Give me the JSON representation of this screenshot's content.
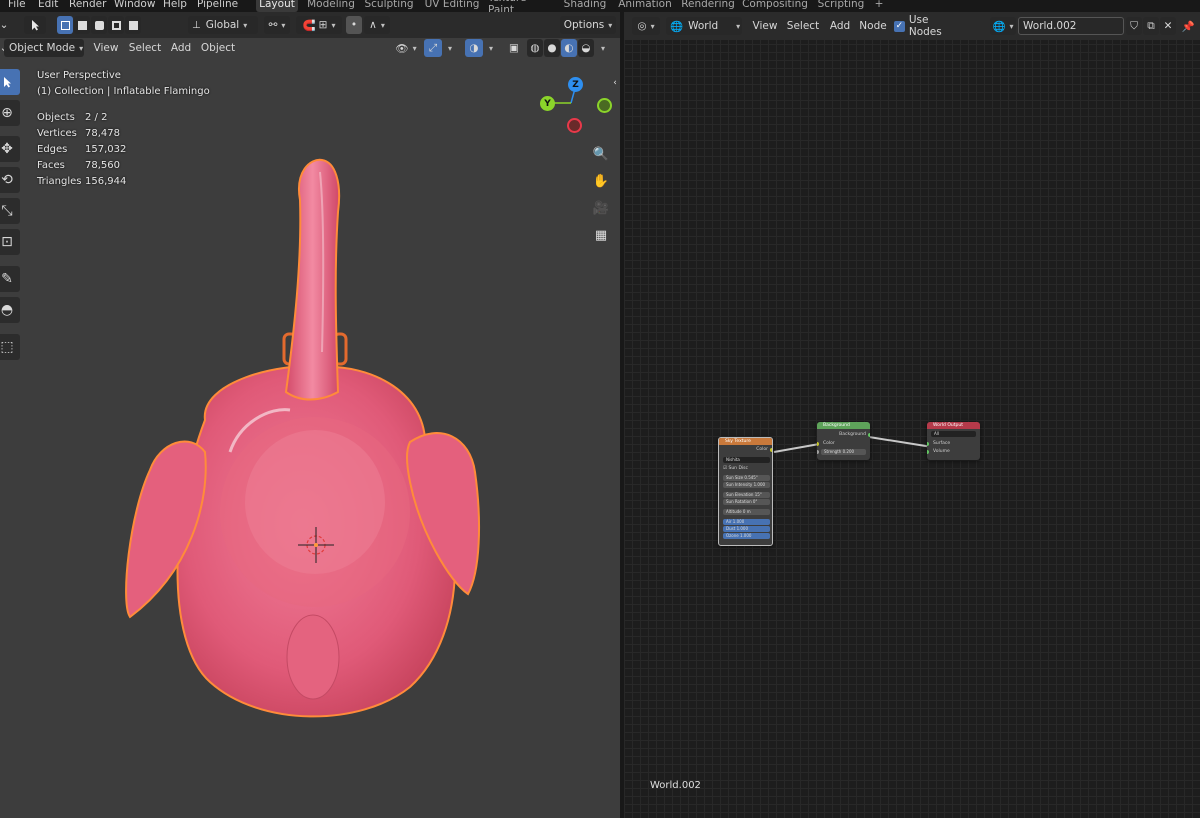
{
  "menu": {
    "items": [
      "File",
      "Edit",
      "Render",
      "Window",
      "Help",
      "Pipeline"
    ]
  },
  "workspaces": {
    "tabs": [
      "Layout",
      "Modeling",
      "Sculpting",
      "UV Editing",
      "Texture Paint",
      "Shading",
      "Animation",
      "Rendering",
      "Compositing",
      "Scripting"
    ],
    "active": "Layout",
    "add_symbol": "+"
  },
  "viewport": {
    "header": {
      "transform_orientation": "Global",
      "options_label": "Options",
      "mode": "Object Mode",
      "menus": [
        "View",
        "Select",
        "Add",
        "Object"
      ]
    },
    "info": {
      "view_name": "User Perspective",
      "collection": "(1) Collection | Inflatable Flamingo"
    },
    "stats": [
      {
        "key": "Objects",
        "value": "2 / 2"
      },
      {
        "key": "Vertices",
        "value": "78,478"
      },
      {
        "key": "Edges",
        "value": "157,032"
      },
      {
        "key": "Faces",
        "value": "78,560"
      },
      {
        "key": "Triangles",
        "value": "156,944"
      }
    ],
    "gizmo": {
      "z_label": "Z",
      "y_label": "Y",
      "z_color": "#2e8ff0",
      "y_color": "#8bd42a",
      "x_color": "#e8394a"
    },
    "object_color": "#e7607f",
    "outline_color": "#ff8b3a"
  },
  "node_editor": {
    "header": {
      "shader_type": "World",
      "menus": [
        "View",
        "Select",
        "Add",
        "Node"
      ],
      "use_nodes_label": "Use Nodes",
      "world_name": "World.002"
    },
    "footer_label": "World.002",
    "nodes": {
      "sky": {
        "title": "Sky Texture",
        "header_color": "#c9793b",
        "output": "Color",
        "sky_type": "Nishita",
        "sun_disc": "Sun Disc",
        "fields": [
          {
            "label": "Sun Size",
            "value": "0.545°"
          },
          {
            "label": "Sun Intensity",
            "value": "1.000"
          },
          {
            "label": "Sun Elevation",
            "value": "15°"
          },
          {
            "label": "Sun Rotation",
            "value": "0°"
          },
          {
            "label": "Altitude",
            "value": "0 m"
          },
          {
            "label": "Air",
            "value": "1.000"
          },
          {
            "label": "Dust",
            "value": "1.000"
          },
          {
            "label": "Ozone",
            "value": "1.000"
          }
        ]
      },
      "background": {
        "title": "Background",
        "header_color": "#5ea35a",
        "output": "Background",
        "input_color": "Color",
        "strength_label": "Strength",
        "strength_value": "0.200"
      },
      "output": {
        "title": "World Output",
        "header_color": "#b53a4a",
        "target": "All",
        "surface": "Surface",
        "volume": "Volume"
      }
    }
  }
}
